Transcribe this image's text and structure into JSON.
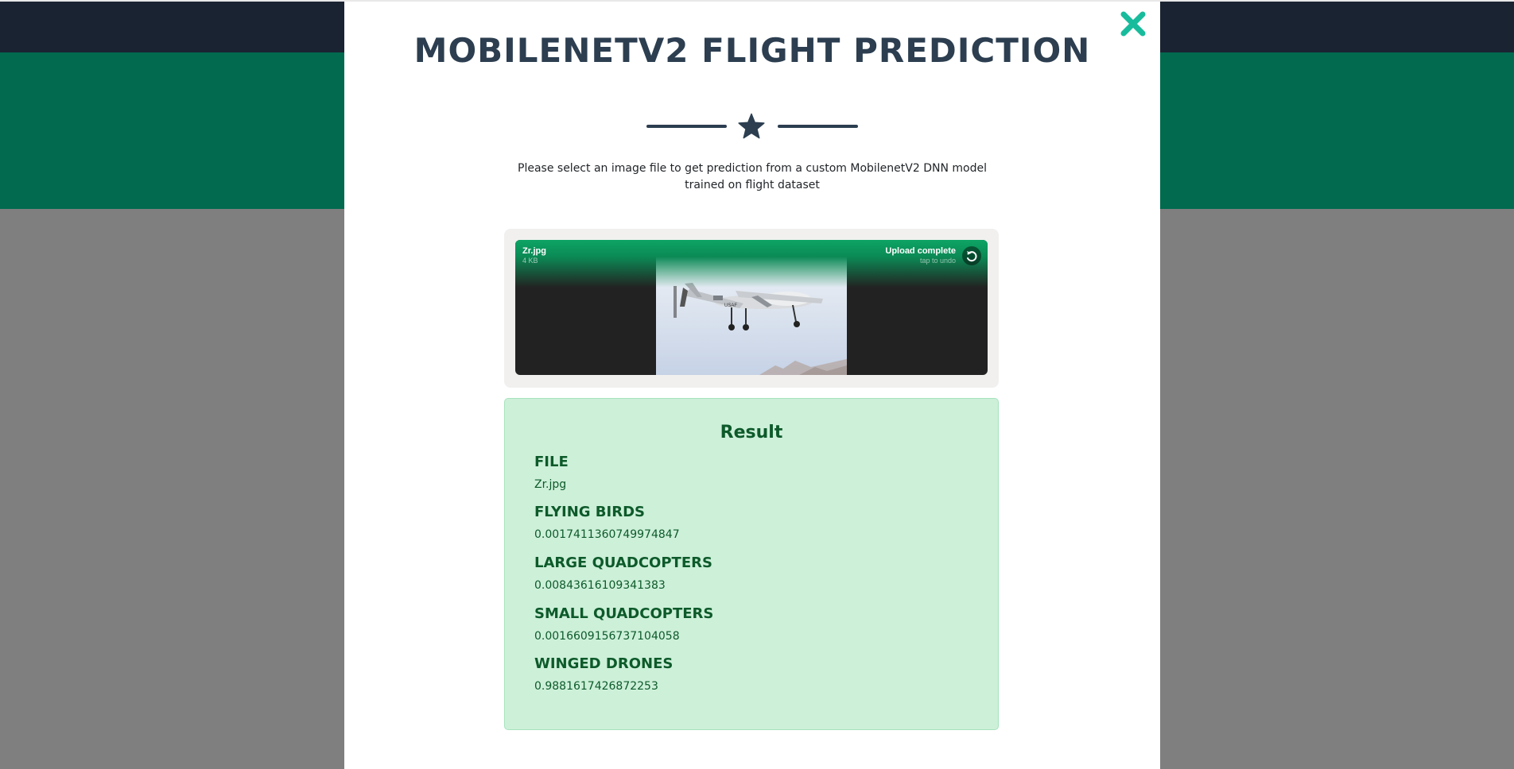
{
  "modal": {
    "title": "MOBILENETV2 FLIGHT PREDICTION",
    "description": "Please select an image file to get prediction from a custom MobilenetV2 DNN model trained on flight dataset",
    "close_icon": "close-icon",
    "divider_icon": "star-icon"
  },
  "upload": {
    "file_name": "Zr.jpg",
    "file_size": "4 KB",
    "status": "Upload complete",
    "status_hint": "tap to undo",
    "undo_icon": "undo-icon",
    "preview_subject": "drone-image"
  },
  "result": {
    "title": "Result",
    "items": [
      {
        "label": "FILE",
        "value": "Zr.jpg"
      },
      {
        "label": "FLYING BIRDS",
        "value": "0.0017411360749974847"
      },
      {
        "label": "LARGE QUADCOPTERS",
        "value": "0.00843616109341383"
      },
      {
        "label": "SMALL QUADCOPTERS",
        "value": "0.0016609156737104058"
      },
      {
        "label": "WINGED DRONES",
        "value": "0.9881617426872253"
      }
    ]
  },
  "colors": {
    "accent": "#18bc9c",
    "primary_dark": "#2c3e50",
    "hero_green": "#016a4f",
    "navbar": "#1a2332",
    "success_bg": "#cdf0d9",
    "success_text": "#0d5a2a"
  }
}
